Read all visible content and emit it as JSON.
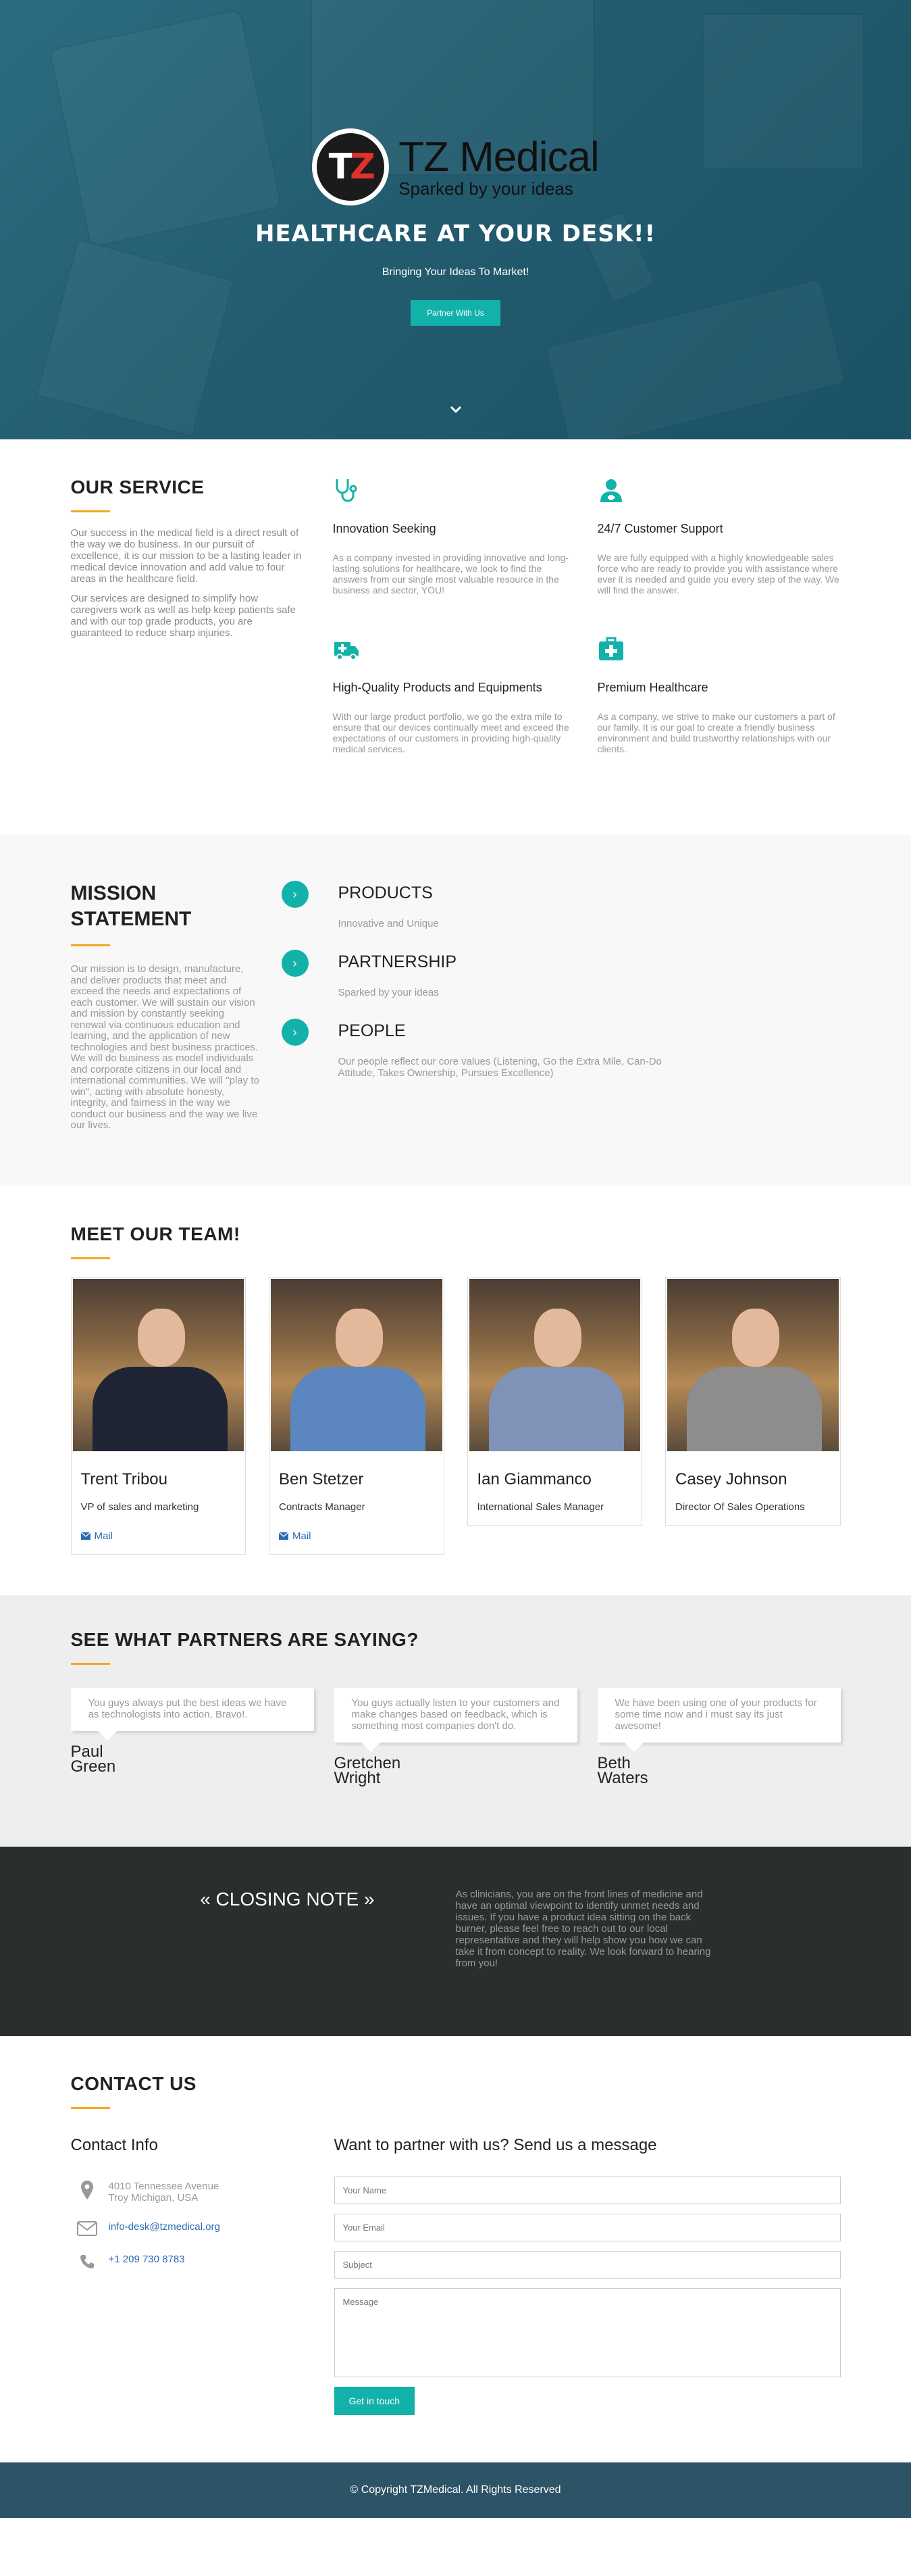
{
  "hero": {
    "brand_name": "TZ Medical",
    "brand_tagline": "Sparked by your ideas",
    "title": "HEALTHCARE AT YOUR DESK!!",
    "subtitle": "Bringing Your Ideas To Market!",
    "cta_label": "Partner With Us"
  },
  "service": {
    "title": "OUR SERVICE",
    "paragraphs": [
      "Our success in the medical field is a direct result of the way we do business. In our pursuit of excellence, it is our mission to be a lasting leader in medical device innovation and add value to four areas in the healthcare field.",
      "Our services are designed to simplify how caregivers work as well as help keep patients safe and with our top grade products, you are guaranteed to reduce sharp injuries."
    ],
    "items": [
      {
        "icon": "stethoscope-icon",
        "title": "Innovation Seeking",
        "text": "As a company invested in providing innovative and long-lasting solutions for healthcare, we look to find the answers from our single most valuable resource in the business and sector, YOU!"
      },
      {
        "icon": "user-md-icon",
        "title": "24/7 Customer Support",
        "text": "We are fully equipped with a highly knowledgeable sales force who are ready to provide you with assistance where ever it is needed and guide you every step of the way. We will find the answer."
      },
      {
        "icon": "ambulance-icon",
        "title": "High-Quality Products and Equipments",
        "text": "With our large product portfolio, we go the extra mile to ensure that our devices continually meet and exceed the expectations of our customers in providing high-quality medical services."
      },
      {
        "icon": "medkit-icon",
        "title": "Premium Healthcare",
        "text": "As a company, we strive to make our customers a part of our family. It is our goal to create a friendly business environment and build trustworthy relationships with our clients."
      }
    ]
  },
  "mission": {
    "title": "MISSION STATEMENT",
    "text": "Our mission is to design, manufacture, and deliver products that meet and exceed the needs and expectations of each customer. We will sustain our vision and mission by constantly seeking renewal via continuous education and learning, and the application of new technologies and best business practices. We will do business as model individuals and corporate citizens in our local and international communities. We will \"play to win\", acting with absolute honesty, integrity, and fairness in the way we conduct our business and the way we live our lives.",
    "items": [
      {
        "title": "PRODUCTS",
        "text": "Innovative and Unique"
      },
      {
        "title": "PARTNERSHIP",
        "text": "Sparked by your ideas"
      },
      {
        "title": "PEOPLE",
        "text": "Our people reflect our core values (Listening, Go the Extra Mile, Can-Do Attitude, Takes Ownership, Pursues Excellence)"
      }
    ]
  },
  "team": {
    "title": "MEET OUR TEAM!",
    "mail_label": "Mail",
    "members": [
      {
        "name": "Trent Tribou",
        "role": "VP of sales and marketing",
        "has_mail": true,
        "suit": "#1e2433"
      },
      {
        "name": "Ben Stetzer",
        "role": "Contracts Manager",
        "has_mail": true,
        "suit": "#5b86c0"
      },
      {
        "name": "Ian Giammanco",
        "role": "International Sales Manager",
        "has_mail": false,
        "suit": "#7f92b8"
      },
      {
        "name": "Casey Johnson",
        "role": "Director Of Sales Operations",
        "has_mail": false,
        "suit": "#8d8d8d"
      }
    ]
  },
  "testimonials": {
    "title": "SEE WHAT PARTNERS ARE SAYING?",
    "items": [
      {
        "quote": "You guys always put the best ideas we have as technologists into action, Bravo!.",
        "first": "Paul",
        "last": "Green"
      },
      {
        "quote": "You guys actually listen to your customers and make changes based on feedback, which is something most companies don't do.",
        "first": "Gretchen",
        "last": "Wright"
      },
      {
        "quote": "We have been using one of your products for some time now and i must say its just awesome!",
        "first": "Beth",
        "last": "Waters"
      }
    ]
  },
  "closing": {
    "title": "« CLOSING NOTE »",
    "text": "As clinicians, you are on the front lines of medicine and have an optimal viewpoint to identify unmet needs and issues. If you have a product idea sitting on the back burner, please feel free to reach out to our local representative and they will help show you how we can take it from concept to reality. We look forward to hearing from you!"
  },
  "contact": {
    "title": "CONTACT US",
    "info_title": "Contact Info",
    "address_line1": "4010 Tennessee Avenue",
    "address_line2": "Troy Michigan, USA",
    "email": "info-desk@tzmedical.org",
    "phone": "+1 209 730 8783",
    "form_title": "Want to partner with us? Send us a message",
    "name_placeholder": "Your Name",
    "email_placeholder": "Your Email",
    "subject_placeholder": "Subject",
    "message_placeholder": "Message",
    "submit_label": "Get in touch"
  },
  "footer": {
    "copyright": "© Copyright TZMedical. All Rights Reserved"
  },
  "colors": {
    "accent": "#12b2aa",
    "underline": "#f5a623",
    "hero_overlay": "#2e6274",
    "closing_bg": "#2a2e2c",
    "footer_bg": "#2d5366"
  }
}
